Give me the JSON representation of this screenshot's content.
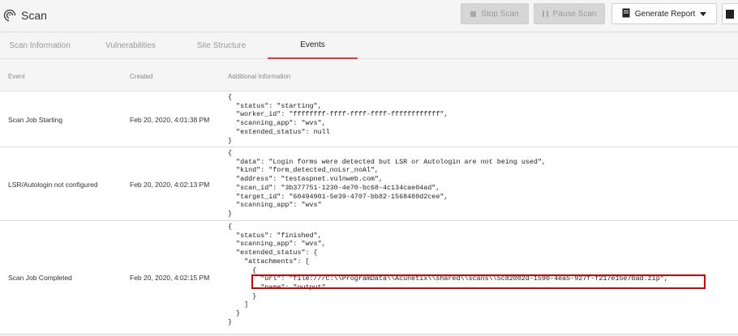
{
  "header": {
    "title": "Scan",
    "stop_label": "Stop Scan",
    "pause_label": "Pause Scan",
    "report_label": "Generate Report"
  },
  "tabs": [
    {
      "label": "Scan Information",
      "active": false
    },
    {
      "label": "Vulnerabilities",
      "active": false
    },
    {
      "label": "Site Structure",
      "active": false
    },
    {
      "label": "Events",
      "active": true
    }
  ],
  "table": {
    "columns": [
      "Event",
      "Created",
      "Additional Information"
    ],
    "rows": [
      {
        "event": "Scan Job Starting",
        "created": "Feb 20, 2020, 4:01:38 PM",
        "info": "{\n  \"status\": \"starting\",\n  \"worker_id\": \"ffffffff-ffff-ffff-ffff-ffffffffffff\",\n  \"scanning_app\": \"wvs\",\n  \"extended_status\": null\n}"
      },
      {
        "event": "LSR/Autologin not configured",
        "created": "Feb 20, 2020, 4:02:13 PM",
        "info": "{\n  \"data\": \"Login forms were detected but LSR or Autologin are not being used\",\n  \"kind\": \"form_detected_noLsr_noAl\",\n  \"address\": \"testaspnet.vulnweb.com\",\n  \"scan_id\": \"3b377751-1230-4e70-bc68-4c134cae04ad\",\n  \"target_id\": \"60494901-5e39-4707-bb82-1568480d2cee\",\n  \"scanning_app\": \"wvs\"\n}"
      },
      {
        "event": "Scan Job Completed",
        "created": "Feb 20, 2020, 4:02:15 PM",
        "info": "{\n  \"status\": \"finished\",\n  \"scanning_app\": \"wvs\",\n  \"extended_status\": {\n    \"attachments\": [\n      {\n        \"url\": \"file:///C:\\\\ProgramData\\\\Acunetix\\\\shared\\\\scans\\\\5c82002d-1590-4ea5-927f-f217e15e7bad.zip\",\n        \"name\": \"output\"\n      }\n    ]\n  }\n}"
      }
    ]
  },
  "colors": {
    "accent": "#e53935",
    "highlight": "#e00000"
  }
}
